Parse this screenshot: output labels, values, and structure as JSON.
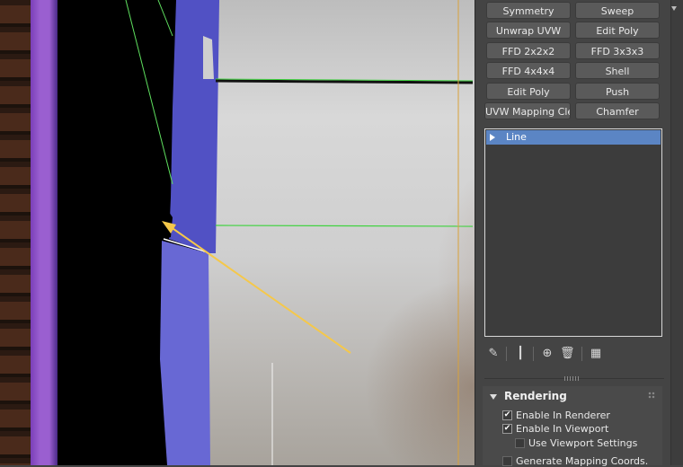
{
  "modifier_buttons": [
    {
      "label": "Symmetry"
    },
    {
      "label": "Sweep"
    },
    {
      "label": "Unwrap UVW"
    },
    {
      "label": "Edit Poly"
    },
    {
      "label": "FFD 2x2x2"
    },
    {
      "label": "FFD 3x3x3"
    },
    {
      "label": "FFD 4x4x4"
    },
    {
      "label": "Shell"
    },
    {
      "label": "Edit Poly"
    },
    {
      "label": "Push"
    },
    {
      "label": "UVW Mapping Clear"
    },
    {
      "label": "Chamfer"
    }
  ],
  "modifier_stack": {
    "items": [
      {
        "label": "Line"
      }
    ]
  },
  "stack_toolbar": {
    "icons": [
      "pin-stack-icon",
      "show-end-result-icon",
      "make-unique-icon",
      "remove-modifier-icon",
      "configure-modifier-sets-icon"
    ]
  },
  "rendering_rollout": {
    "title": "Rendering",
    "options": [
      {
        "label": "Enable In Renderer",
        "checked": true
      },
      {
        "label": "Enable In Viewport",
        "checked": true
      },
      {
        "label": "Use Viewport Settings",
        "checked": false
      },
      {
        "label": "Generate Mapping Coords.",
        "checked": false
      }
    ]
  },
  "colors": {
    "selection_blue": "#5b85c4",
    "spline_green": "#3fd23f",
    "arrow_yellow": "#f5c84a",
    "mesh_blue": "#5a5ad0",
    "purple_frame": "#9a5fd0"
  }
}
